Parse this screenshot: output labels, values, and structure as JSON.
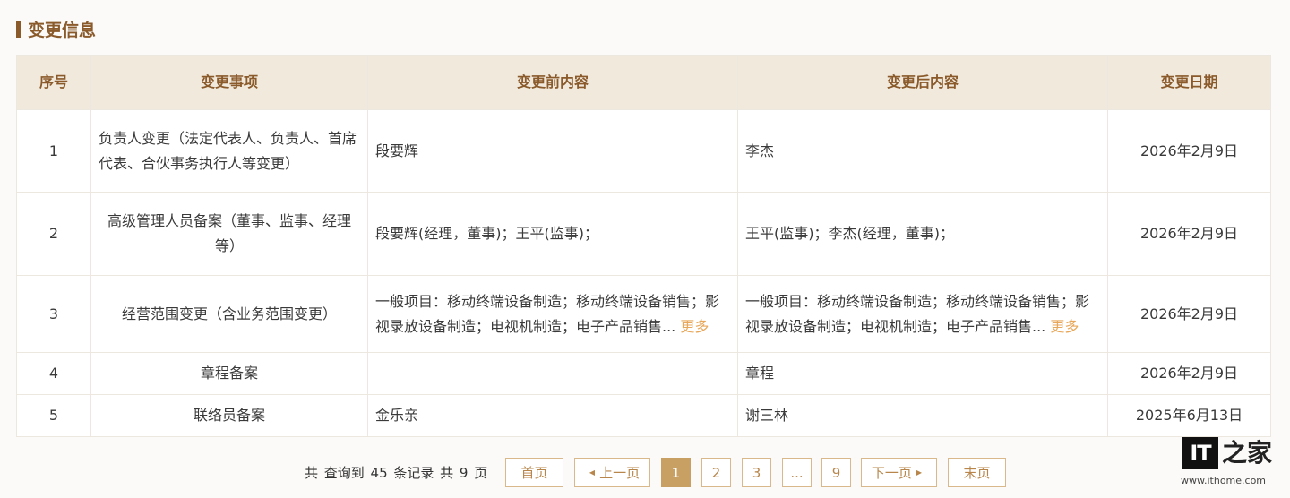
{
  "section": {
    "title": "变更信息"
  },
  "table": {
    "headers": [
      "序号",
      "变更事项",
      "变更前内容",
      "变更后内容",
      "变更日期"
    ],
    "rows": [
      {
        "no": "1",
        "item": "负责人变更（法定代表人、负责人、首席代表、合伙事务执行人等变更）",
        "before": "段要辉",
        "after": "李杰",
        "date": "2026年2月9日"
      },
      {
        "no": "2",
        "item": "高级管理人员备案（董事、监事、经理等）",
        "before": "段要辉(经理，董事)；王平(监事)；",
        "after": "王平(监事)；李杰(经理，董事)；",
        "date": "2026年2月9日"
      },
      {
        "no": "3",
        "item": "经营范围变更（含业务范围变更）",
        "before": "一般项目：移动终端设备制造；移动终端设备销售；影视录放设备制造；电视机制造；电子产品销售...",
        "after": "一般项目：移动终端设备制造；移动终端设备销售；影视录放设备制造；电视机制造；电子产品销售...",
        "date": "2026年2月9日"
      },
      {
        "no": "4",
        "item": "章程备案",
        "before": "",
        "after": "章程",
        "date": "2026年2月9日"
      },
      {
        "no": "5",
        "item": "联络员备案",
        "before": "金乐亲",
        "after": "谢三林",
        "date": "2025年6月13日"
      }
    ],
    "more_label": "更多"
  },
  "pagination": {
    "summary": "共 查询到 45 条记录 共 9 页",
    "first": "首页",
    "prev": "上一页",
    "pages": [
      "1",
      "2",
      "3",
      "...",
      "9"
    ],
    "current": "1",
    "next": "下一页",
    "last": "末页"
  },
  "watermark": {
    "brand": "IT",
    "brand_zh": "之家",
    "url": "www.ithome.com"
  },
  "colors": {
    "accent": "#8a5a2b",
    "header_bg": "#f0e9dc",
    "link": "#e8a85c",
    "active_page": "#c9a064"
  }
}
